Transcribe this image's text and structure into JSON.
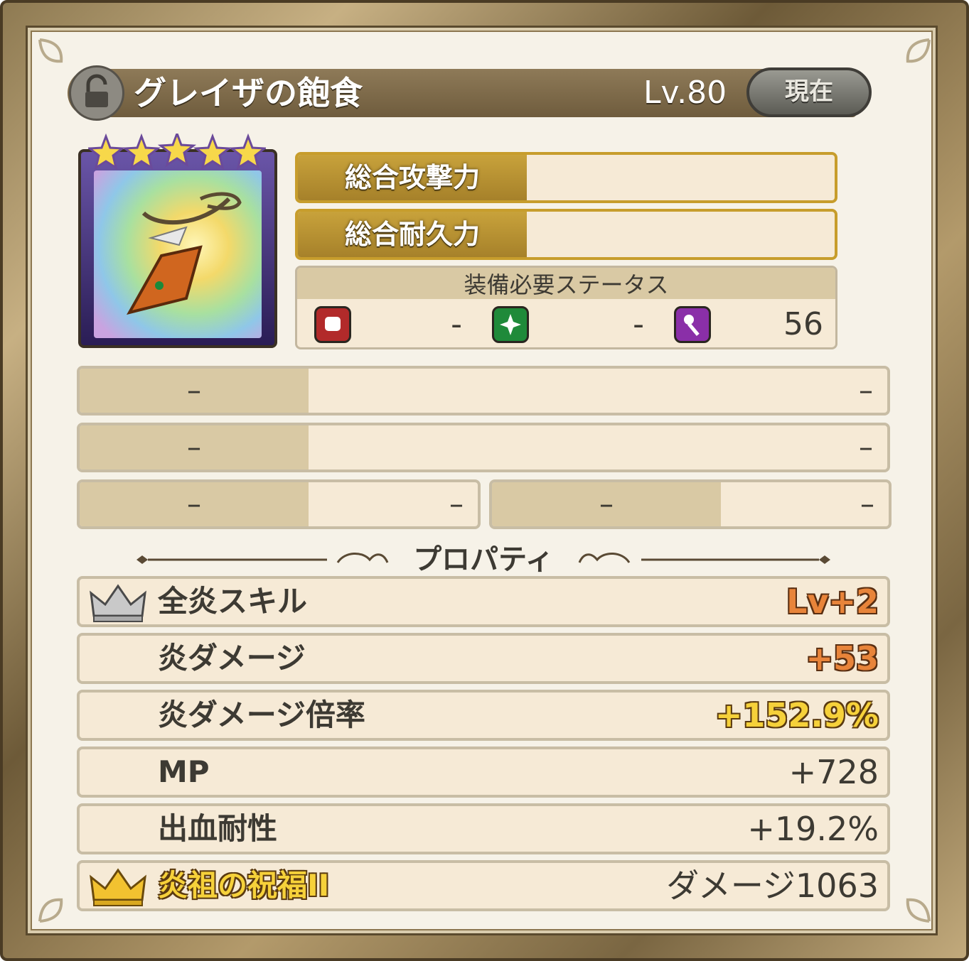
{
  "header": {
    "title": "グレイザの飽食",
    "level": "Lv.80",
    "current_button": "現在"
  },
  "item": {
    "rarity_stars": 5,
    "icon": "pendant-icon"
  },
  "stats": {
    "attack_label": "総合攻撃力",
    "attack_value": "",
    "defense_label": "総合耐久力",
    "defense_value": ""
  },
  "requirements": {
    "heading": "装備必要ステータス",
    "items": [
      {
        "icon": "fist-icon",
        "value": "-"
      },
      {
        "icon": "sparkle-icon",
        "value": "-"
      },
      {
        "icon": "staff-icon",
        "value": "56"
      }
    ]
  },
  "empty_rows": {
    "row1": {
      "left": "–",
      "right": "–"
    },
    "row2": {
      "left": "–",
      "right": "–"
    },
    "row3a": {
      "left": "–",
      "right": "–"
    },
    "row3b": {
      "left": "–",
      "right": "–"
    }
  },
  "properties_heading": "プロパティ",
  "properties": [
    {
      "label": "全炎スキル",
      "value": "Lv+2",
      "crown": "silver"
    },
    {
      "label": "炎ダメージ",
      "value": "+53"
    },
    {
      "label": "炎ダメージ倍率",
      "value": "+152.9%"
    },
    {
      "label": "MP",
      "value": "+728"
    },
    {
      "label": "出血耐性",
      "value": "+19.2%"
    },
    {
      "label": "炎祖の祝福II",
      "value": "ダメージ1063",
      "crown": "gold"
    }
  ],
  "colors": {
    "stat_gold": "#c79d2c",
    "value_orange": "#e8843a",
    "value_yellow": "#f6d13a"
  }
}
